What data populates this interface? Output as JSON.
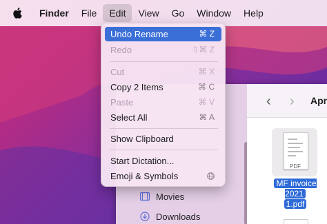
{
  "menubar": {
    "apple_icon": "apple-logo-icon",
    "items": [
      "Finder",
      "File",
      "Edit",
      "View",
      "Go",
      "Window",
      "Help"
    ]
  },
  "edit_menu": {
    "items": [
      {
        "label": "Undo Rename",
        "shortcut": "⌘ Z",
        "highlighted": true
      },
      {
        "label": "Redo",
        "shortcut": "⇧⌘ Z",
        "disabled": true
      },
      {
        "label": "Cut",
        "shortcut": "⌘ X",
        "disabled": true
      },
      {
        "label": "Copy 2 Items",
        "shortcut": "⌘ C"
      },
      {
        "label": "Paste",
        "shortcut": "⌘ V",
        "disabled": true
      },
      {
        "label": "Select All",
        "shortcut": "⌘ A"
      },
      {
        "label": "Show Clipboard"
      },
      {
        "label": "Start Dictation..."
      },
      {
        "label": "Emoji & Symbols",
        "shortcut_icon": "globe-icon"
      }
    ]
  },
  "finder": {
    "breadcrumb": "Apr",
    "sidebar": [
      {
        "label": "Movies",
        "icon": "film-icon"
      },
      {
        "label": "Downloads",
        "icon": "download-icon"
      }
    ],
    "file": {
      "name_line1": "MF invoice 2021",
      "name_line2": "1.pdf",
      "badge": "PDF"
    }
  },
  "colors": {
    "highlight": "#3b6fd8",
    "selection": "#2f6bd8"
  }
}
